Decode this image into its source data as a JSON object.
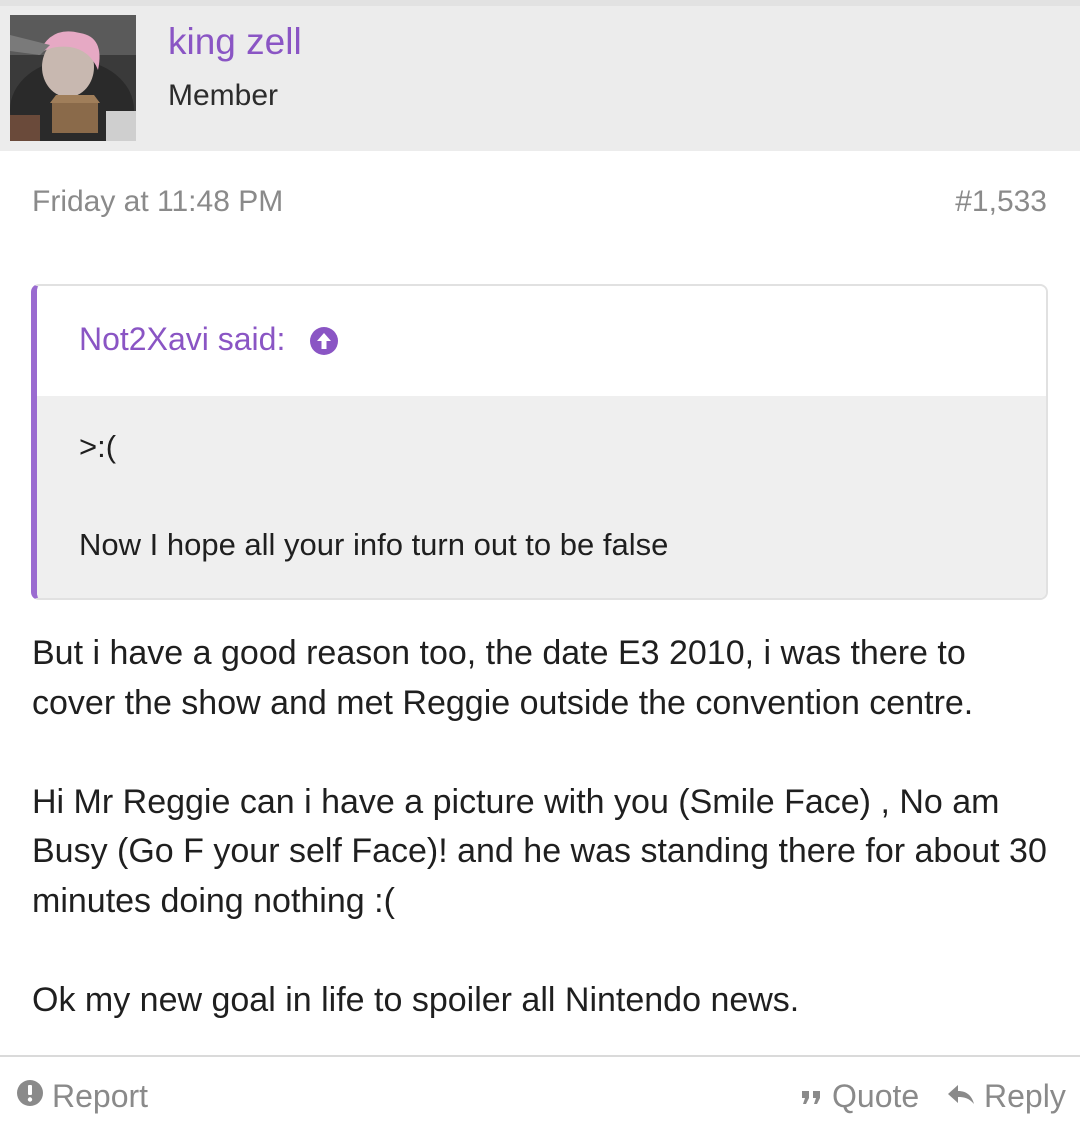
{
  "user": {
    "name": "king zell",
    "title": "Member"
  },
  "post": {
    "date": "Friday at 11:48 PM",
    "number": "#1,533"
  },
  "quote": {
    "author": "Not2Xavi said:",
    "lines": [
      ">:(",
      "Now I hope all your info turn out to be false"
    ]
  },
  "message": {
    "paragraphs": [
      "But i have a good reason too, the date E3 2010, i was there to cover the show and met Reggie outside the convention centre.",
      "Hi Mr Reggie can i have a picture with you (Smile Face) , No am Busy (Go F your self Face)! and he was standing there for about 30 minutes doing nothing :(",
      "Ok my new goal in life to spoiler all Nintendo news."
    ]
  },
  "actions": {
    "report": "Report",
    "quote": "Quote",
    "reply": "Reply"
  },
  "colors": {
    "accent": "#8a55c4",
    "quote_border": "#9a6bd0",
    "header_bg": "#ececec",
    "muted_text": "#8a8a8a"
  },
  "icons": {
    "quote_jump": "arrow-up-circle-icon",
    "report": "exclamation-circle-icon",
    "quote": "quote-marks-icon",
    "reply": "reply-arrow-icon"
  }
}
